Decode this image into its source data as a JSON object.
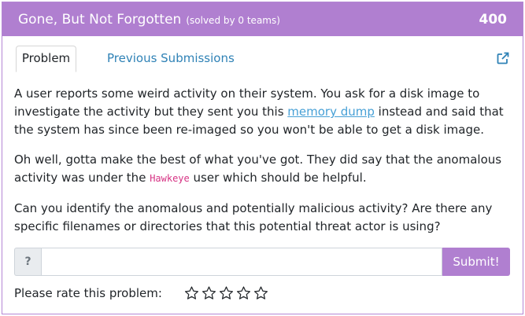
{
  "header": {
    "title": "Gone, But Not Forgotten",
    "solved": "(solved by 0 teams)",
    "points": "400",
    "bg_color": "#b07fd0"
  },
  "tabs": {
    "problem": "Problem",
    "previous": "Previous Submissions",
    "external_icon": "external-link-icon"
  },
  "body": {
    "p1_before": "A user reports some weird activity on their system. You ask for a disk image to investigate the activity but they sent you this ",
    "p1_link": "memory dump",
    "p1_after": " instead and said that the system has since been re-imaged so you won't be able to get a disk image.",
    "p2_before": "Oh well, gotta make the best of what you've got. They did say that the anomalous activity was under the ",
    "p2_code": "Hawkeye",
    "p2_after": " user which should be helpful.",
    "p3": "Can you identify the anomalous and potentially malicious activity? Are there any specific filenames or directories that this potential threat actor is using?"
  },
  "answer": {
    "prefix": "?",
    "value": "",
    "placeholder": "",
    "submit_label": "Submit!"
  },
  "rating": {
    "label": "Please rate this problem:",
    "star_icon": "star-outline-icon",
    "stars_filled": 0,
    "stars_total": 5
  }
}
